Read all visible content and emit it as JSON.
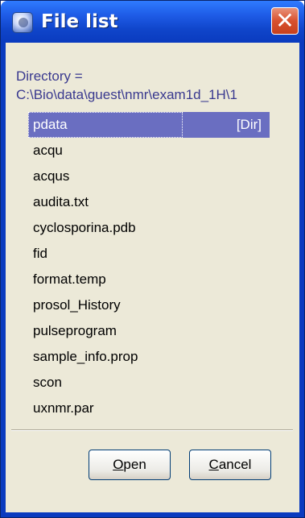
{
  "window": {
    "title": "File list"
  },
  "directory": {
    "label": "Directory =",
    "path": "C:\\Bio\\data\\guest\\nmr\\exam1d_1H\\1"
  },
  "files": [
    {
      "name": "pdata",
      "tag": "[Dir]",
      "selected": true
    },
    {
      "name": "acqu"
    },
    {
      "name": "acqus"
    },
    {
      "name": "audita.txt"
    },
    {
      "name": "cyclosporina.pdb"
    },
    {
      "name": "fid"
    },
    {
      "name": "format.temp"
    },
    {
      "name": "prosol_History"
    },
    {
      "name": "pulseprogram"
    },
    {
      "name": "sample_info.prop"
    },
    {
      "name": "scon"
    },
    {
      "name": "uxnmr.par"
    }
  ],
  "buttons": {
    "open_mnemonic": "O",
    "open_rest": "pen",
    "cancel_mnemonic": "C",
    "cancel_rest": "ancel"
  },
  "colors": {
    "title_bar": "#0f44c9",
    "selection": "#6a6ec1",
    "label_text": "#39398f",
    "close_button": "#d8512e"
  },
  "icons": {
    "app": "app-globe-icon",
    "close": "close-x-icon"
  }
}
